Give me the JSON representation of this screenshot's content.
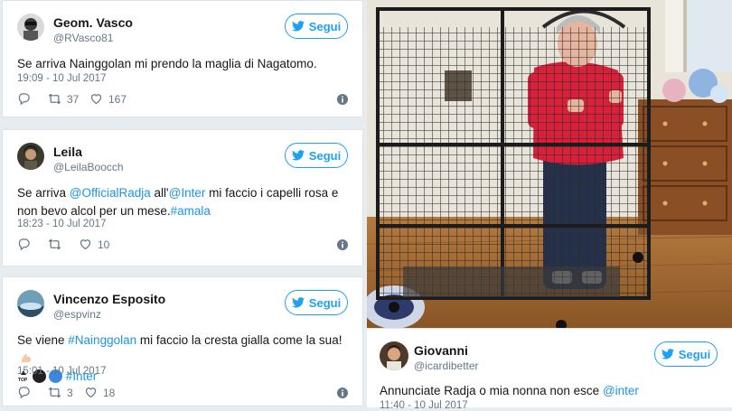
{
  "tweets": [
    {
      "name": "Geom. Vasco",
      "handle": "@RVasco81",
      "follow_label": "Segui",
      "text_parts": [
        "Se arriva Nainggolan mi prendo la maglia di Nagatomo."
      ],
      "time": "19:09 - 10 Jul 2017",
      "retweets": "37",
      "likes": "167"
    },
    {
      "name": "Leila",
      "handle": "@LeilaBoocch",
      "follow_label": "Segui",
      "text": {
        "pre": "Se arriva ",
        "mention1": "@OfficialRadja",
        "mid": " all'",
        "mention2": "@Inter",
        "rest": " mi faccio i capelli rosa e non bevo alcol per un mese.",
        "hashtag": "#amala"
      },
      "time": "18:23 - 10 Jul 2017",
      "retweets": "",
      "likes": "10"
    },
    {
      "name": "Vincenzo Esposito",
      "handle": "@espvinz",
      "follow_label": "Segui",
      "text": {
        "pre": "Se viene ",
        "hashtag1": "#Nainggolan",
        "rest": " mi faccio la cresta gialla come la sua!",
        "hashtag2": "#Inter"
      },
      "time": "15:01 - 10 Jul 2017",
      "retweets": "3",
      "likes": "18"
    }
  ],
  "photo_tweet": {
    "name": "Giovanni",
    "handle": "@icardibetter",
    "follow_label": "Segui",
    "text": {
      "pre": "Annunciate Radja o mia nonna non esce ",
      "mention": "@inter"
    },
    "time": "11:40 - 10 Jul 2017"
  },
  "colors": {
    "twitter_blue": "#1da1f2",
    "link_blue": "#1b95e0",
    "muted": "#657786"
  }
}
